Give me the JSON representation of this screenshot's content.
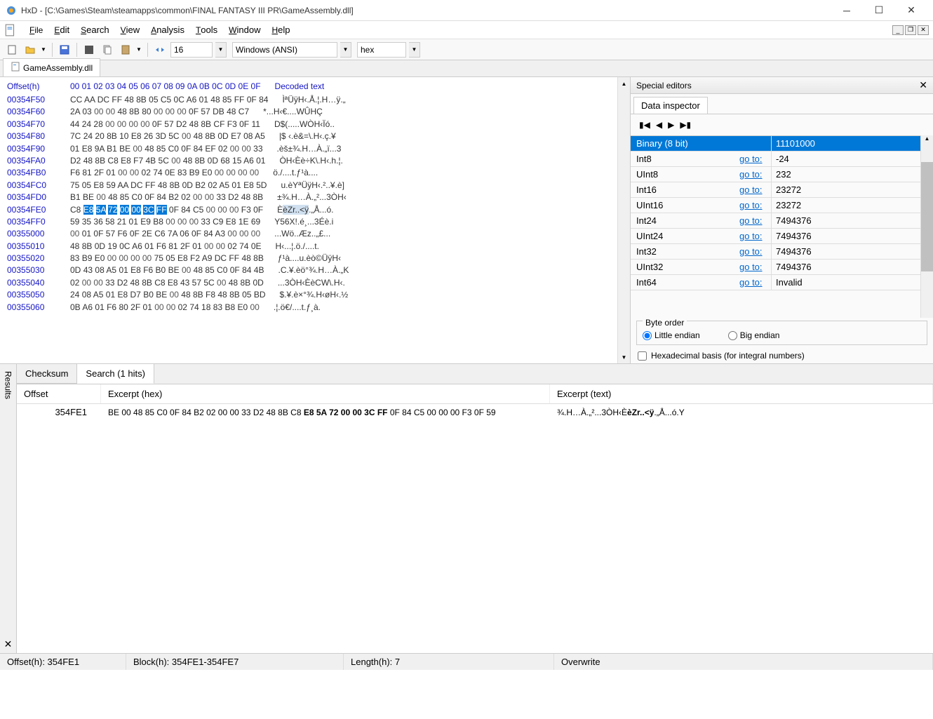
{
  "window": {
    "title": "HxD - [C:\\Games\\Steam\\steamapps\\common\\FINAL FANTASY III PR\\GameAssembly.dll]"
  },
  "menu": {
    "file": "File",
    "edit": "Edit",
    "search": "Search",
    "view": "View",
    "analysis": "Analysis",
    "tools": "Tools",
    "window": "Window",
    "help": "Help"
  },
  "toolbar": {
    "bytes_per_row": "16",
    "charset": "Windows (ANSI)",
    "number_base": "hex"
  },
  "doc_tab": "GameAssembly.dll",
  "hex": {
    "offset_header": "Offset(h)",
    "col_header": "00 01 02 03 04 05 06 07 08 09 0A 0B 0C 0D 0E 0F",
    "decoded_header": "Decoded text",
    "rows": [
      {
        "addr": "00354F50",
        "bytes": "CC AA DC FF 48 8B 05 C5 0C A6 01 48 85 FF 0F 84",
        "text": "ÌªÜÿH‹.Å.¦.H…ÿ.„"
      },
      {
        "addr": "00354F60",
        "bytes": "2A 03 00 00 48 8B 80 00 00 00 0F 57 DB 48 C7",
        "text": "*...H‹€....WÛHÇ"
      },
      {
        "addr": "00354F70",
        "bytes": "44 24 28 00 00 00 00 0F 57 D2 48 8B CF F3 0F 11",
        "text": "D$(.....WÒH‹Ïó.."
      },
      {
        "addr": "00354F80",
        "bytes": "7C 24 20 8B 10 E8 26 3D 5C 00 48 8B 0D E7 08 A5",
        "text": "|$ ‹.è&=\\.H‹.ç.¥"
      },
      {
        "addr": "00354F90",
        "bytes": "01 E8 9A B1 BE 00 48 85 C0 0F 84 EF 02 00 00 33",
        "text": ".èš±¾.H…À.„ï...3"
      },
      {
        "addr": "00354FA0",
        "bytes": "D2 48 8B C8 E8 F7 4B 5C 00 48 8B 0D 68 15 A6 01",
        "text": "ÒH‹Èè÷K\\.H‹.h.¦."
      },
      {
        "addr": "00354FB0",
        "bytes": "F6 81 2F 01 00 00 02 74 0E 83 B9 E0 00 00 00 00",
        "text": "ö./....t.ƒ¹à...."
      },
      {
        "addr": "00354FC0",
        "bytes": "75 05 E8 59 AA DC FF 48 8B 0D B2 02 A5 01 E8 5D",
        "text": "u.èYªÜÿH‹.²..¥.è]"
      },
      {
        "addr": "00354FD0",
        "bytes": "B1 BE 00 48 85 C0 0F 84 B2 02 00 00 33 D2 48 8B",
        "text": "±¾.H…À.„²...3ÒH‹"
      },
      {
        "addr": "00354FE0",
        "bytes": "C8 E8 5A 72 00 00 3C FF 0F 84 C5 00 00 00 F3 0F",
        "text": "ÈèZr..<ÿ.„Å...ó.",
        "highlight_start": 1,
        "highlight_end": 7,
        "text_highlight_start": 1,
        "text_highlight_end": 7
      },
      {
        "addr": "00354FF0",
        "bytes": "59 35 36 58 21 01 E9 B8 00 00 00 33 C9 E8 1E 69",
        "text": "Y56X!.é¸...3Éè.i"
      },
      {
        "addr": "00355000",
        "bytes": "00 01 0F 57 F6 0F 2E C6 7A 06 0F 84 A3 00 00 00",
        "text": "...Wö..Æz..„£..."
      },
      {
        "addr": "00355010",
        "bytes": "48 8B 0D 19 0C A6 01 F6 81 2F 01 00 00 02 74 0E",
        "text": "H‹...¦.ö./....t."
      },
      {
        "addr": "00355020",
        "bytes": "83 B9 E0 00 00 00 00 75 05 E8 F2 A9 DC FF 48 8B",
        "text": "ƒ¹à....u.èò©ÜÿH‹"
      },
      {
        "addr": "00355030",
        "bytes": "0D 43 08 A5 01 E8 F6 B0 BE 00 48 85 C0 0F 84 4B",
        "text": ".C.¥.èö°¾.H…À.„K"
      },
      {
        "addr": "00355040",
        "bytes": "02 00 00 33 D2 48 8B C8 E8 43 57 5C 00 48 8B 0D",
        "text": "...3ÒH‹ÈèCW\\.H‹."
      },
      {
        "addr": "00355050",
        "bytes": "24 08 A5 01 E8 D7 B0 BE 00 48 8B F8 48 8B 05 BD",
        "text": "$.¥.è×°¾.H‹øH‹.½"
      },
      {
        "addr": "00355060",
        "bytes": "0B A6 01 F6 80 2F 01 00 00 02 74 18 83 B8 E0 00",
        "text": ".¦.ö€/....t.ƒ¸à."
      }
    ]
  },
  "inspector": {
    "title": "Special editors",
    "tab": "Data inspector",
    "rows": [
      {
        "label": "Binary (8 bit)",
        "goto": "",
        "value": "11101000",
        "selected": true
      },
      {
        "label": "Int8",
        "goto": "go to:",
        "value": "-24"
      },
      {
        "label": "UInt8",
        "goto": "go to:",
        "value": "232"
      },
      {
        "label": "Int16",
        "goto": "go to:",
        "value": "23272"
      },
      {
        "label": "UInt16",
        "goto": "go to:",
        "value": "23272"
      },
      {
        "label": "Int24",
        "goto": "go to:",
        "value": "7494376"
      },
      {
        "label": "UInt24",
        "goto": "go to:",
        "value": "7494376"
      },
      {
        "label": "Int32",
        "goto": "go to:",
        "value": "7494376"
      },
      {
        "label": "UInt32",
        "goto": "go to:",
        "value": "7494376"
      },
      {
        "label": "Int64",
        "goto": "go to:",
        "value": "Invalid"
      }
    ],
    "byte_order_label": "Byte order",
    "little_endian": "Little endian",
    "big_endian": "Big endian",
    "hex_basis": "Hexadecimal basis (for integral numbers)"
  },
  "results": {
    "sidebar_label": "Results",
    "checksum_tab": "Checksum",
    "search_tab": "Search (1 hits)",
    "header_offset": "Offset",
    "header_hex": "Excerpt (hex)",
    "header_text": "Excerpt (text)",
    "row": {
      "offset": "354FE1",
      "hex_pre": "BE 00 48 85 C0 0F 84 B2 02 00 00 33 D2 48 8B C8 ",
      "hex_bold": "E8 5A 72 00 00 3C FF",
      "hex_post": " 0F 84 C5 00 00 00 F3 0F 59",
      "text_pre": "¾.H…À.„²...3ÒH‹È",
      "text_bold": "èZr..<ÿ",
      "text_post": ".„Å...ó.Y"
    }
  },
  "statusbar": {
    "offset": "Offset(h): 354FE1",
    "block": "Block(h): 354FE1-354FE7",
    "length": "Length(h): 7",
    "mode": "Overwrite"
  }
}
